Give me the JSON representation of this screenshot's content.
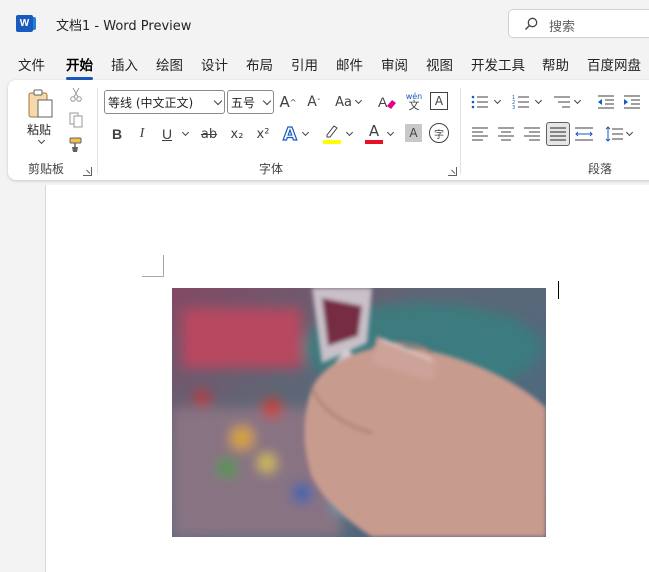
{
  "window": {
    "title": "文档1 - Word Preview",
    "app_letter": "W"
  },
  "search": {
    "placeholder": "搜索"
  },
  "tabs": [
    {
      "label": "文件"
    },
    {
      "label": "开始"
    },
    {
      "label": "插入"
    },
    {
      "label": "绘图"
    },
    {
      "label": "设计"
    },
    {
      "label": "布局"
    },
    {
      "label": "引用"
    },
    {
      "label": "邮件"
    },
    {
      "label": "审阅"
    },
    {
      "label": "视图"
    },
    {
      "label": "开发工具"
    },
    {
      "label": "帮助"
    },
    {
      "label": "百度网盘"
    }
  ],
  "active_tab": "开始",
  "clipboard": {
    "paste_label": "粘贴",
    "group_label": "剪贴板"
  },
  "font": {
    "font_name": "等线 (中文正文)",
    "font_size": "五号",
    "group_label": "字体",
    "bold": "B",
    "italic": "I",
    "underline": "U",
    "strikethrough": "ab",
    "subscript": "x₂",
    "superscript": "x²",
    "grow": "A^",
    "shrink": "A˅",
    "change_case": "Aa",
    "phonetic_top": "wén",
    "phonetic_bottom": "文",
    "text_effects": "A",
    "font_color": "A",
    "shading": "A",
    "border_char": "A",
    "enclose": "字",
    "highlight_color": "#ffff00",
    "font_color_value": "#e81123"
  },
  "paragraph": {
    "group_label": "段落"
  },
  "colors": {
    "accent": "#185abd",
    "ribbon_bg": "#ffffff",
    "app_bg": "#f3f3f3"
  }
}
